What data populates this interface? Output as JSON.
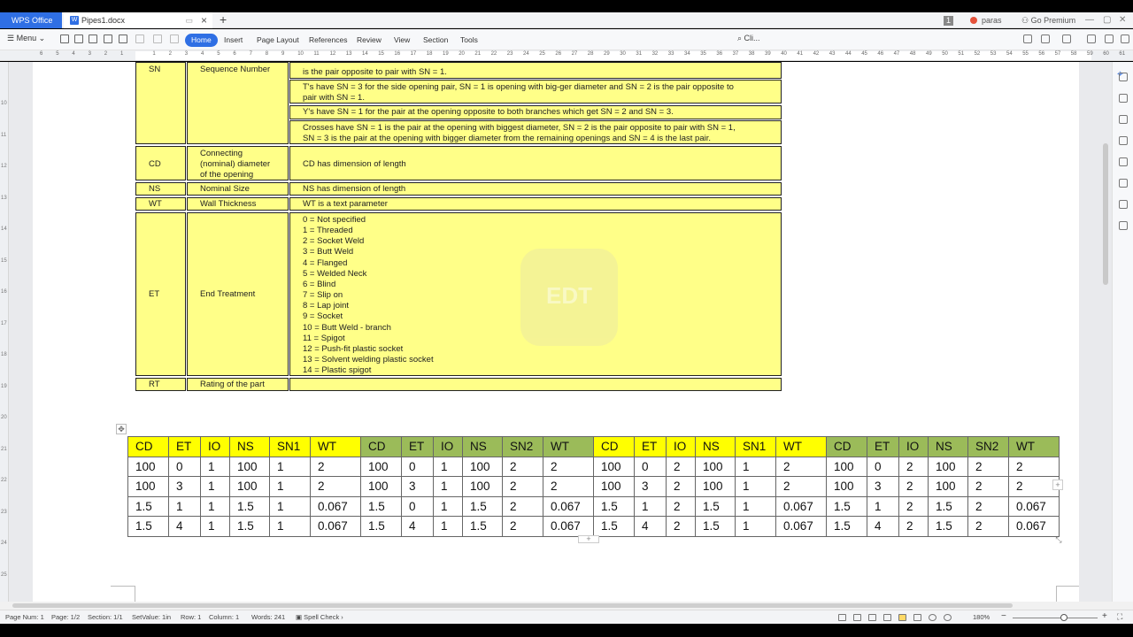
{
  "titlebar": {
    "app_name": "WPS Office",
    "doc_tab": "Pipes1.docx",
    "new_tab": "+",
    "badge": "1",
    "user": "paras",
    "premium": "Go Premium"
  },
  "ribbon": {
    "menu": "Menu",
    "tabs": [
      "Home",
      "Insert",
      "Page Layout",
      "References",
      "Review",
      "View",
      "Section",
      "Tools"
    ],
    "active_tab": "Home",
    "search": "Cli..."
  },
  "ruler": {
    "ticks": [
      "6",
      "5",
      "4",
      "3",
      "2",
      "1",
      "",
      "1",
      "2",
      "3",
      "4",
      "5",
      "6",
      "7",
      "8",
      "9",
      "10",
      "11",
      "12",
      "13",
      "14",
      "15",
      "16",
      "17",
      "18",
      "19",
      "20",
      "21",
      "22",
      "23",
      "24",
      "25",
      "26",
      "27",
      "28",
      "29",
      "30",
      "31",
      "32",
      "33",
      "34",
      "35",
      "36",
      "37",
      "38",
      "39",
      "40",
      "41",
      "42",
      "43",
      "44",
      "45",
      "46",
      "47",
      "48",
      "49",
      "50",
      "51",
      "52",
      "53",
      "54",
      "55",
      "56",
      "57",
      "58",
      "59",
      "60",
      "61"
    ],
    "vticks": [
      "10",
      "11",
      "12",
      "13",
      "14",
      "15",
      "16",
      "17",
      "18",
      "19",
      "20",
      "21",
      "22",
      "23",
      "24",
      "25"
    ]
  },
  "def_table": {
    "sn": {
      "code": "SN",
      "name": "Sequence Number",
      "rows": [
        "is the pair opposite to pair with SN = 1.",
        "T's have SN = 3 for the side opening pair, SN = 1 is opening with big-ger diameter and SN = 2 is the pair opposite to",
        "pair with SN = 1.",
        "Y's have SN = 1 for the pair at the opening opposite to both branches which get SN = 2 and SN = 3.",
        "Crosses have SN = 1 is the pair at the opening with biggest diameter, SN = 2 is the pair opposite to pair with SN = 1,",
        "SN = 3 is the pair at the opening with bigger diameter from the remaining openings and SN = 4 is the last pair."
      ]
    },
    "cd": {
      "code": "CD",
      "name_lines": [
        "Connecting",
        "(nominal) diameter",
        "of the opening"
      ],
      "desc": "CD has dimension of length"
    },
    "ns": {
      "code": "NS",
      "name": "Nominal Size",
      "desc": "NS has dimension of length"
    },
    "wt": {
      "code": "WT",
      "name": "Wall Thickness",
      "desc": "WT is a text parameter"
    },
    "et": {
      "code": "ET",
      "name": "End Treatment",
      "items": [
        "0 = Not specified",
        "1 = Threaded",
        "2 = Socket Weld",
        "3 = Butt Weld",
        "4 = Flanged",
        "5 = Welded Neck",
        "6 = Blind",
        "7 = Slip on",
        "8 = Lap joint",
        "9 = Socket",
        "10 = Butt Weld - branch",
        "11 = Spigot",
        "12 = Push-fit plastic socket",
        "13 = Solvent welding plastic socket",
        "14 = Plastic spigot"
      ]
    },
    "rt": {
      "code": "RT",
      "name": "Rating of the part"
    }
  },
  "watermark": "EDT",
  "data_table": {
    "header": [
      "CD",
      "ET",
      "IO",
      "NS",
      "SN1",
      "WT",
      "CD",
      "ET",
      "IO",
      "NS",
      "SN2",
      "WT",
      "CD",
      "ET",
      "IO",
      "NS",
      "SN1",
      "WT",
      "CD",
      "ET",
      "IO",
      "NS",
      "SN2",
      "WT"
    ],
    "header_colors": [
      "y",
      "y",
      "y",
      "y",
      "y",
      "y",
      "g",
      "g",
      "g",
      "g",
      "g",
      "g",
      "y",
      "y",
      "y",
      "y",
      "y",
      "y",
      "g",
      "g",
      "g",
      "g",
      "g",
      "g"
    ],
    "rows": [
      [
        "100",
        "0",
        "1",
        "100",
        "1",
        "2",
        "100",
        "0",
        "1",
        "100",
        "2",
        "2",
        "100",
        "0",
        "2",
        "100",
        "1",
        "2",
        "100",
        "0",
        "2",
        "100",
        "2",
        "2"
      ],
      [
        "100",
        "3",
        "1",
        "100",
        "1",
        "2",
        "100",
        "3",
        "1",
        "100",
        "2",
        "2",
        "100",
        "3",
        "2",
        "100",
        "1",
        "2",
        "100",
        "3",
        "2",
        "100",
        "2",
        "2"
      ],
      [
        "1.5",
        "1",
        "1",
        "1.5",
        "1",
        "0.067",
        "1.5",
        "0",
        "1",
        "1.5",
        "2",
        "0.067",
        "1.5",
        "1",
        "2",
        "1.5",
        "1",
        "0.067",
        "1.5",
        "1",
        "2",
        "1.5",
        "2",
        "0.067"
      ],
      [
        "1.5",
        "4",
        "1",
        "1.5",
        "1",
        "0.067",
        "1.5",
        "4",
        "1",
        "1.5",
        "2",
        "0.067",
        "1.5",
        "4",
        "2",
        "1.5",
        "1",
        "0.067",
        "1.5",
        "4",
        "2",
        "1.5",
        "2",
        "0.067"
      ]
    ]
  },
  "statusbar": {
    "page_num": "Page Num: 1",
    "page": "Page: 1/2",
    "section": "Section: 1/1",
    "setvalue": "SetValue: 1in",
    "row": "Row: 1",
    "column": "Column: 1",
    "words": "Words: 241",
    "spell": "Spell Check",
    "zoom": "180%"
  }
}
